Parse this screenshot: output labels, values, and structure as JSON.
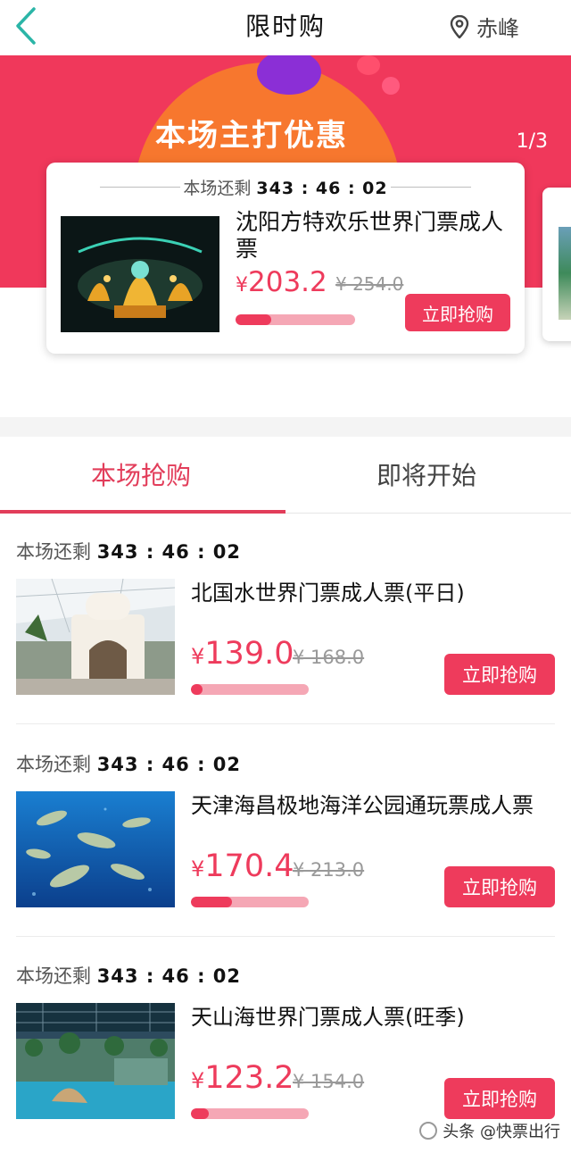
{
  "header": {
    "title": "限时购",
    "location": "赤峰"
  },
  "banner": {
    "title": "本场主打优惠",
    "pager": "1/3",
    "card": {
      "countdown_label": "本场还剩",
      "countdown": "343 : 46 : 02",
      "name": "沈阳方特欢乐世界门票成人票",
      "price_symbol": "¥",
      "price": "203.2",
      "old_price": "¥ 254.0",
      "progress": 0.3,
      "button": "立即抢购"
    }
  },
  "tabs": [
    {
      "label": "本场抢购",
      "active": true
    },
    {
      "label": "即将开始",
      "active": false
    }
  ],
  "items": [
    {
      "countdown_label": "本场还剩",
      "countdown": "343 : 46 : 02",
      "name": "北国水世界门票成人票(平日)",
      "price_symbol": "¥",
      "price": "139.0",
      "old_price": "¥ 168.0",
      "progress": 0.1,
      "button": "立即抢购",
      "image": "waterpark-tower"
    },
    {
      "countdown_label": "本场还剩",
      "countdown": "343 : 46 : 02",
      "name": "天津海昌极地海洋公园通玩票成人票",
      "price_symbol": "¥",
      "price": "170.4",
      "old_price": "¥ 213.0",
      "progress": 0.35,
      "button": "立即抢购",
      "image": "ocean-fish"
    },
    {
      "countdown_label": "本场还剩",
      "countdown": "343 : 46 : 02",
      "name": "天山海世界门票成人票(旺季)",
      "price_symbol": "¥",
      "price": "123.2",
      "old_price": "¥ 154.0",
      "progress": 0.15,
      "button": "立即抢购",
      "image": "indoor-waterpark"
    }
  ],
  "watermark": "头条 @快票出行",
  "colors": {
    "accent": "#ee3b5c",
    "banner_red": "#f0385b",
    "tab_active": "#e23d5a"
  }
}
